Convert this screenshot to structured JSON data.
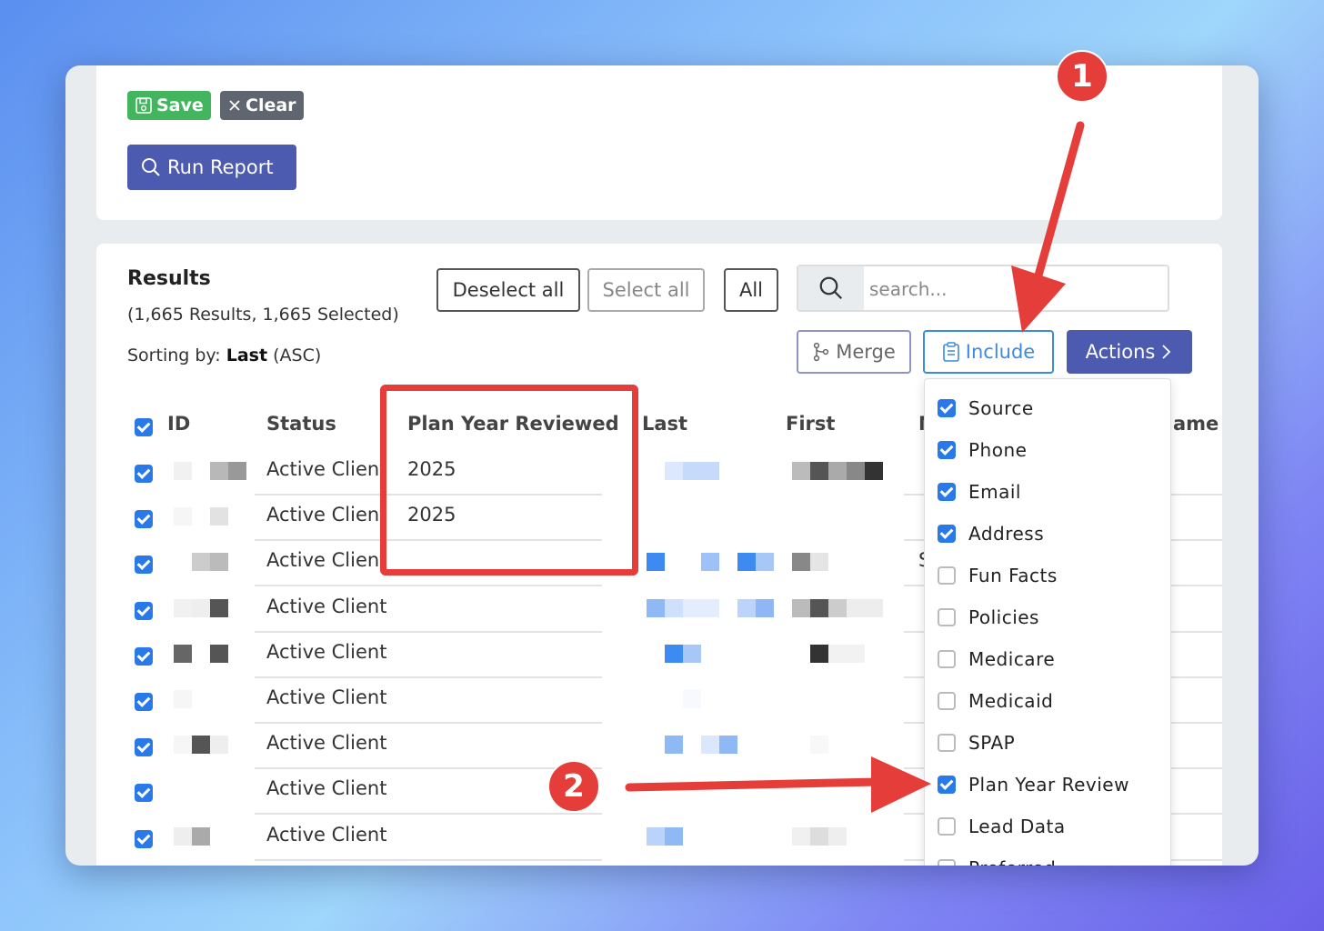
{
  "toolbar": {
    "save_label": "Save",
    "clear_label": "Clear",
    "run_report_label": "Run Report"
  },
  "results": {
    "title": "Results",
    "summary": "(1,665 Results, 1,665 Selected)",
    "sorting_prefix": "Sorting by:",
    "sorting_field": "Last",
    "sorting_order": "(ASC)",
    "deselect_all_label": "Deselect all",
    "select_all_label": "Select all",
    "all_label": "All",
    "search_placeholder": "search...",
    "merge_label": "Merge",
    "include_label": "Include",
    "actions_label": "Actions"
  },
  "table": {
    "headers": {
      "id": "ID",
      "status": "Status",
      "plan_year": "Plan Year Reviewed",
      "last": "Last",
      "first": "First",
      "partial_m": "M",
      "partial_name": "ame"
    },
    "rows": [
      {
        "status": "Active Client",
        "plan_year": "2025",
        "partial": ""
      },
      {
        "status": "Active Client",
        "plan_year": "2025",
        "partial": ""
      },
      {
        "status": "Active Client",
        "plan_year": "",
        "partial": "S"
      },
      {
        "status": "Active Client",
        "plan_year": "",
        "partial": ""
      },
      {
        "status": "Active Client",
        "plan_year": "",
        "partial": ""
      },
      {
        "status": "Active Client",
        "plan_year": "",
        "partial": ""
      },
      {
        "status": "Active Client",
        "plan_year": "",
        "partial": ""
      },
      {
        "status": "Active Client",
        "plan_year": "",
        "partial": ""
      },
      {
        "status": "Active Client",
        "plan_year": "",
        "partial": ""
      }
    ]
  },
  "include_menu": {
    "items": [
      {
        "label": "Source",
        "checked": true
      },
      {
        "label": "Phone",
        "checked": true
      },
      {
        "label": "Email",
        "checked": true
      },
      {
        "label": "Address",
        "checked": true
      },
      {
        "label": "Fun Facts",
        "checked": false
      },
      {
        "label": "Policies",
        "checked": false
      },
      {
        "label": "Medicare",
        "checked": false
      },
      {
        "label": "Medicaid",
        "checked": false
      },
      {
        "label": "SPAP",
        "checked": false
      },
      {
        "label": "Plan Year Review",
        "checked": true
      },
      {
        "label": "Lead Data",
        "checked": false
      },
      {
        "label": "Preferred",
        "checked": false
      }
    ]
  },
  "annotations": {
    "badge1": "1",
    "badge2": "2"
  },
  "colors": {
    "accent": "#4c5ab0",
    "save": "#43b55e",
    "clear": "#5f6670",
    "include": "#3d8bde",
    "checkbox": "#2979e8",
    "annotation": "#e53d39"
  }
}
